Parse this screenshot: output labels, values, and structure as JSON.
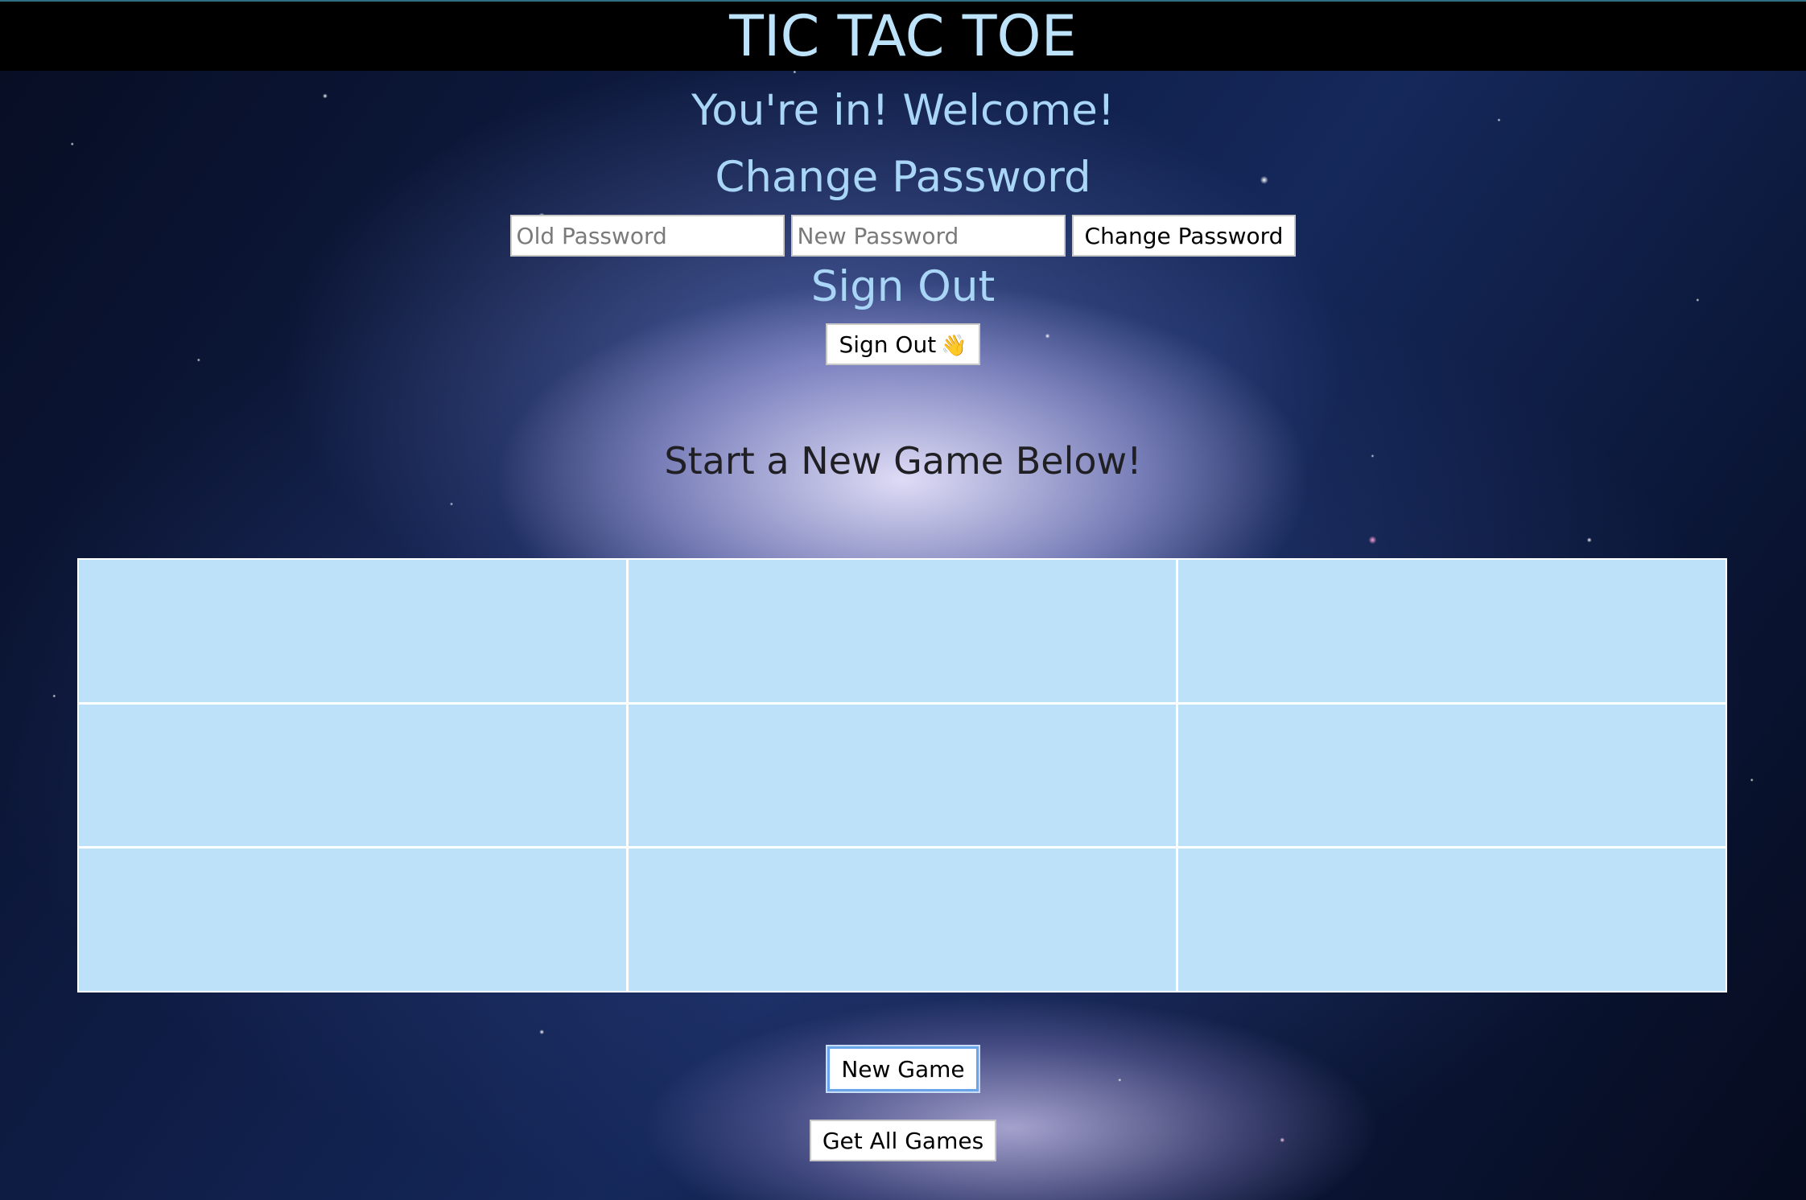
{
  "header": {
    "title": "TIC TAC TOE"
  },
  "auth": {
    "welcome": "You're in! Welcome!",
    "change_password_heading": "Change Password",
    "old_password_placeholder": "Old Password",
    "new_password_placeholder": "New Password",
    "change_password_button": "Change Password",
    "sign_out_heading": "Sign Out",
    "sign_out_button": "Sign Out",
    "sign_out_icon": "👋"
  },
  "game": {
    "start_heading": "Start a New Game Below!",
    "board": {
      "cells": [
        "",
        "",
        "",
        "",
        "",
        "",
        "",
        "",
        ""
      ]
    },
    "new_game_button": "New Game",
    "get_all_games_button": "Get All Games"
  },
  "colors": {
    "header_bg": "#000000",
    "title_text": "#bde3fb",
    "heading_text": "#a9d6f6",
    "cell_bg": "#bce1f9",
    "start_heading_text": "#1f1f24"
  }
}
